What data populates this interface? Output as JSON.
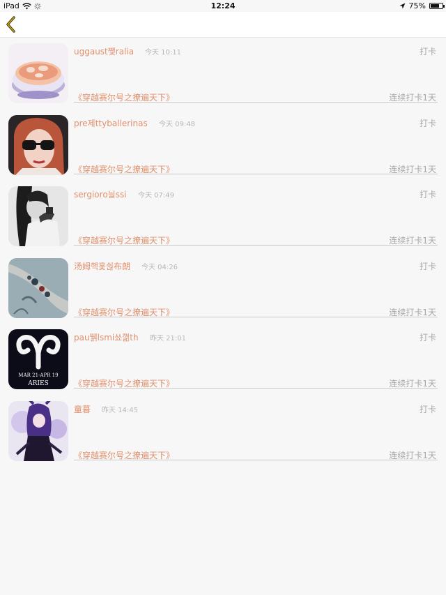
{
  "status_bar": {
    "device": "iPad",
    "time": "12:24",
    "battery": "75%",
    "battery_level": 0.75
  },
  "nav": {
    "back_icon": "chevron-left-icon",
    "accent_color": "#c8a400"
  },
  "colors": {
    "name_color": "#e0906b",
    "muted_text": "#a8a8a8"
  },
  "entries": [
    {
      "username": "uggaust쨏ralia",
      "timestamp": "今天 10:11",
      "checkin_label": "打卡",
      "book_title": "《穿越赛尔号之撩遍天下》",
      "streak": "连续打卡1天",
      "avatar": "food-bowl"
    },
    {
      "username": "pre제ttyballerinas",
      "timestamp": "今天 09:48",
      "checkin_label": "打卡",
      "book_title": "《穿越赛尔号之撩遍天下》",
      "streak": "连续打卡1天",
      "avatar": "sunglasses-woman"
    },
    {
      "username": "sergioro늴ssi",
      "timestamp": "今天 07:49",
      "checkin_label": "打卡",
      "book_title": "《穿越赛尔号之撩遍天下》",
      "streak": "连续打卡1天",
      "avatar": "bw-portrait"
    },
    {
      "username": "汤姆핵홏쉲布朗",
      "timestamp": "今天 04:26",
      "checkin_label": "打卡",
      "book_title": "《穿越赛尔号之撩遍天下》",
      "streak": "连续打卡1天",
      "avatar": "tattoo-arm"
    },
    {
      "username": "pau뛝lsmi쑈껾th",
      "timestamp": "昨天 21:01",
      "checkin_label": "打卡",
      "book_title": "《穿越赛尔号之撩遍天下》",
      "streak": "连续打卡1天",
      "avatar": "aries",
      "avatar_text_1": "MAR 21-APR 19",
      "avatar_text_2": "ARIES"
    },
    {
      "username": "童暮",
      "timestamp": "昨天 14:45",
      "checkin_label": "打卡",
      "book_title": "《穿越赛尔号之撩遍天下》",
      "streak": "连续打卡1天",
      "avatar": "anime-girl"
    }
  ]
}
